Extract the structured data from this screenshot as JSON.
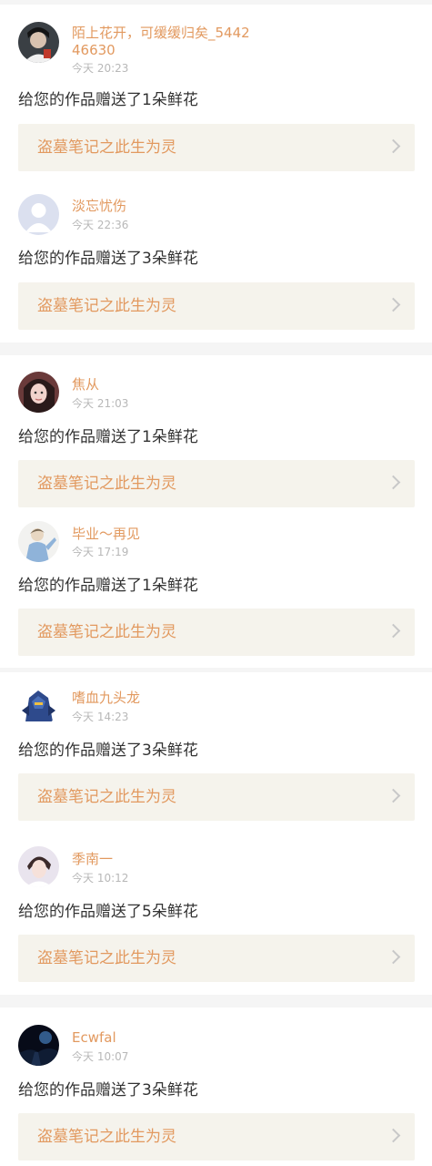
{
  "notices": [
    {
      "name": "陌上花开，可缓缓归矣_544246630",
      "time": "今天 20:23",
      "message": "给您的作品赠送了1朵鲜花",
      "work": "盗墓笔记之此生为灵",
      "avatar": "dark-hair-avatar"
    },
    {
      "name": "淡忘忧伤",
      "time": "今天 22:36",
      "message": "给您的作品赠送了3朵鲜花",
      "work": "盗墓笔记之此生为灵",
      "avatar": "default-avatar"
    },
    {
      "name": "焦从",
      "time": "今天 21:03",
      "message": "给您的作品赠送了1朵鲜花",
      "work": "盗墓笔记之此生为灵",
      "avatar": "girl-portrait-avatar"
    },
    {
      "name": "毕业～再见",
      "time": "今天 17:19",
      "message": "给您的作品赠送了1朵鲜花",
      "work": "盗墓笔记之此生为灵",
      "avatar": "boy-sketch-avatar"
    },
    {
      "name": "嗜血九头龙",
      "time": "今天 14:23",
      "message": "给您的作品赠送了3朵鲜花",
      "work": "盗墓笔记之此生为灵",
      "avatar": "robot-hero-avatar"
    },
    {
      "name": "季南一",
      "time": "今天 10:12",
      "message": "给您的作品赠送了5朵鲜花",
      "work": "盗墓笔记之此生为灵",
      "avatar": "light-portrait-avatar"
    },
    {
      "name": "Ecwfal",
      "time": "今天 10:07",
      "message": "给您的作品赠送了3朵鲜花",
      "work": "盗墓笔记之此生为灵",
      "avatar": "night-scene-avatar"
    }
  ],
  "colors": {
    "accent": "#e2995f",
    "card_bg": "#f5f3ec",
    "message": "#333333",
    "time": "#b8b8b8"
  }
}
